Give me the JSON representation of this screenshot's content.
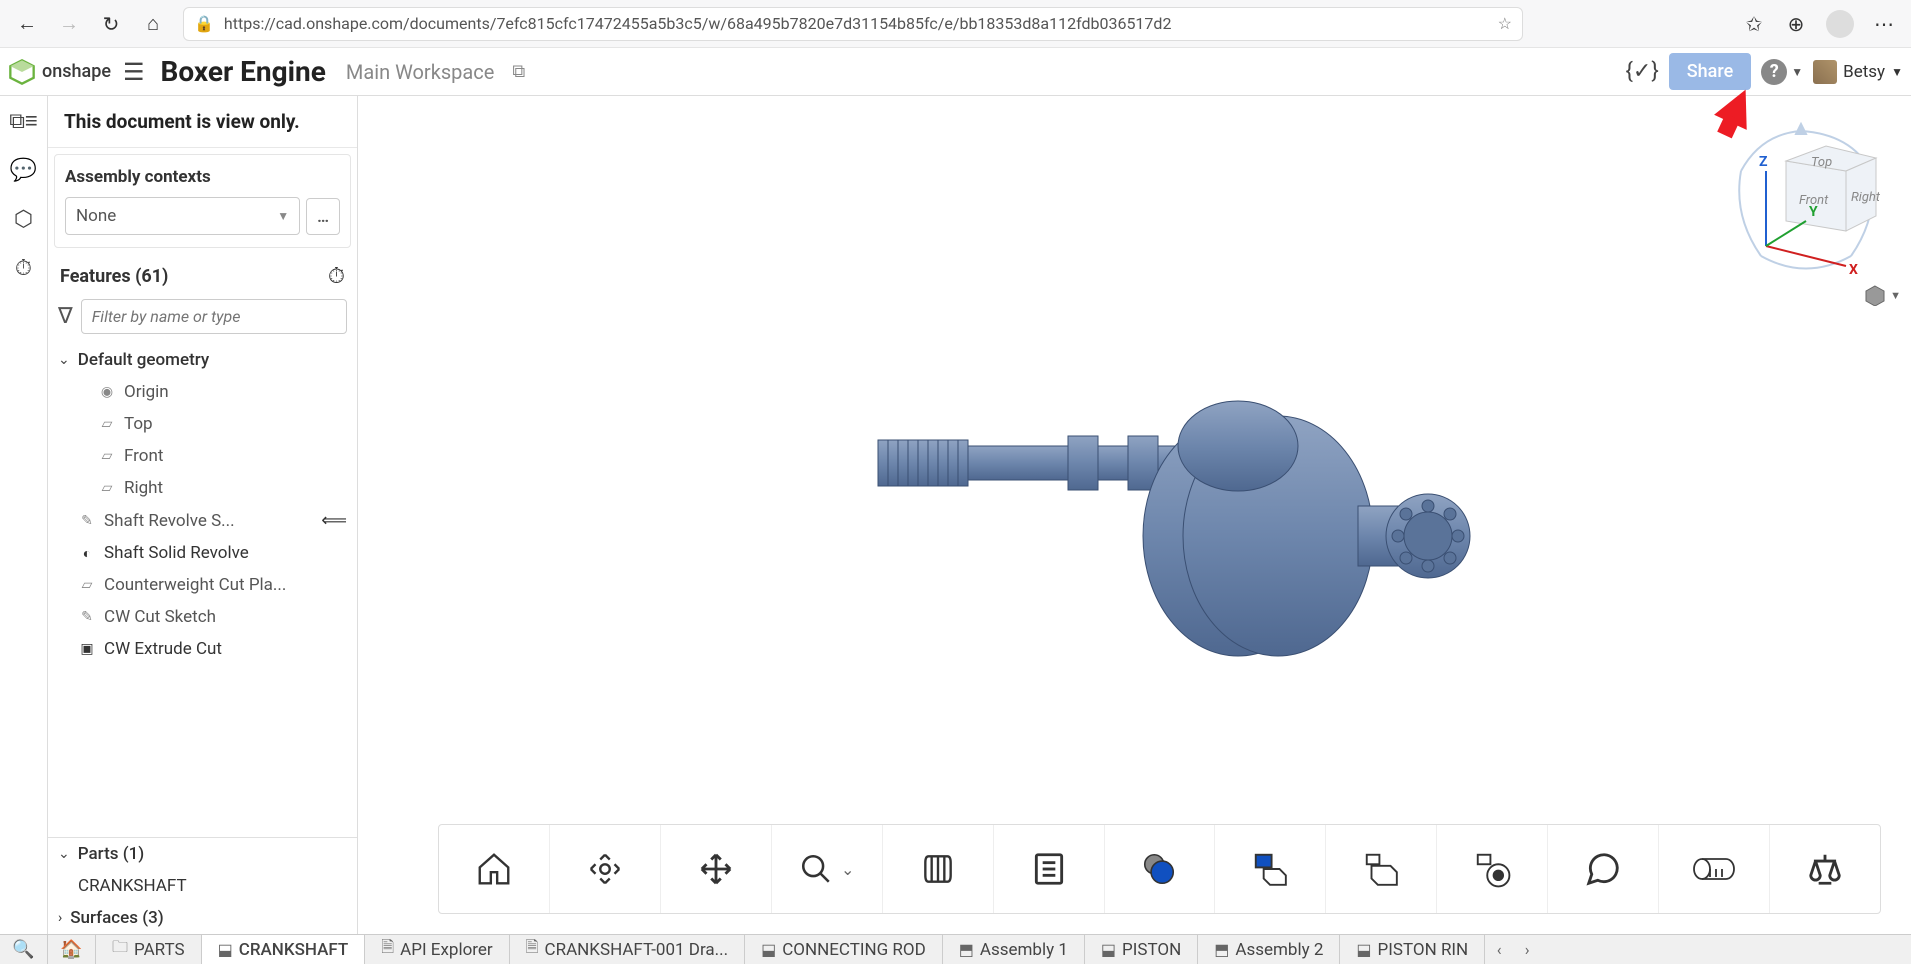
{
  "browser": {
    "url": "https://cad.onshape.com/documents/7efc815cfc17472455a5b3c5/w/68a495b7820e7d31154b85fc/e/bb18353d8a112fdb036517d2"
  },
  "header": {
    "document_title": "Boxer Engine",
    "workspace": "Main Workspace",
    "share_label": "Share",
    "user_name": "Betsy",
    "help_tooltip": "Help menu"
  },
  "panel": {
    "view_only_notice": "This document is view only.",
    "contexts_label": "Assembly contexts",
    "contexts_selected": "None",
    "features_label": "Features (61)",
    "filter_placeholder": "Filter by name or type",
    "tree": {
      "default_geometry": "Default geometry",
      "origin": "Origin",
      "top": "Top",
      "front": "Front",
      "right": "Right",
      "f1": "Shaft Revolve S...",
      "f2": "Shaft Solid Revolve",
      "f3": "Counterweight Cut Pla...",
      "f4": "CW Cut Sketch",
      "f5": "CW Extrude Cut"
    },
    "parts_label": "Parts (1)",
    "part1": "CRANKSHAFT",
    "surfaces_label": "Surfaces (3)"
  },
  "tabs": {
    "t0": "PARTS",
    "t1": "CRANKSHAFT",
    "t2": "API Explorer",
    "t3": "CRANKSHAFT-001 Dra...",
    "t4": "CONNECTING ROD",
    "t5": "Assembly 1",
    "t6": "PISTON",
    "t7": "Assembly 2",
    "t8": "PISTON RIN"
  },
  "viewcube": {
    "top": "Top",
    "front": "Front",
    "right": "Right",
    "x": "X",
    "y": "Y",
    "z": "Z"
  }
}
